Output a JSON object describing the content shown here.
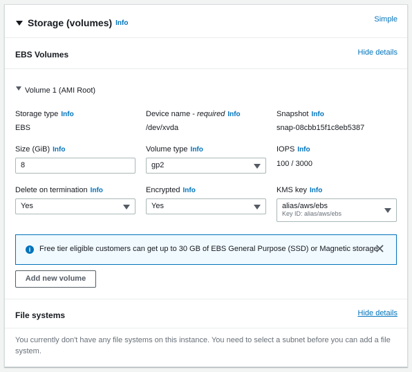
{
  "storage": {
    "title": "Storage (volumes)",
    "info": "Info",
    "simple_link": "Simple"
  },
  "ebs": {
    "title": "EBS Volumes",
    "hide_details": "Hide details",
    "volume": {
      "title": "Volume 1 (AMI Root)",
      "storage_type": {
        "label": "Storage type",
        "info": "Info",
        "value": "EBS"
      },
      "device_name": {
        "label": "Device name - ",
        "label_italic": "required",
        "info": "Info",
        "value": "/dev/xvda"
      },
      "snapshot": {
        "label": "Snapshot",
        "info": "Info",
        "value": "snap-08cbb15f1c8eb5387"
      },
      "size": {
        "label": "Size (GiB)",
        "info": "Info",
        "value": "8"
      },
      "volume_type": {
        "label": "Volume type",
        "info": "Info",
        "value": "gp2"
      },
      "iops": {
        "label": "IOPS",
        "info": "Info",
        "value": "100 / 3000"
      },
      "delete_on_termination": {
        "label": "Delete on termination",
        "info": "Info",
        "value": "Yes"
      },
      "encrypted": {
        "label": "Encrypted",
        "info": "Info",
        "value": "Yes"
      },
      "kms_key": {
        "label": "KMS key",
        "info": "Info",
        "value": "alias/aws/ebs",
        "sub": "Key ID: alias/aws/ebs"
      }
    },
    "alert": "Free tier eligible customers can get up to 30 GB of EBS General Purpose (SSD) or Magnetic storage",
    "add_volume_button": "Add new volume"
  },
  "file_systems": {
    "title": "File systems",
    "hide_details": "Hide details",
    "description": "You currently don't have any file systems on this instance. You need to select a subnet before you can add a file system."
  },
  "colors": {
    "link": "#0073bb",
    "alert_border": "#0073bb",
    "alert_bg": "#f1faff"
  }
}
